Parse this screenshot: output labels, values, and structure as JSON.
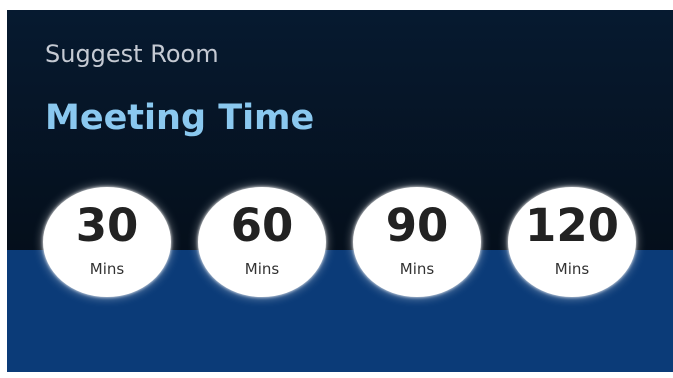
{
  "header": {
    "subtitle": "Suggest Room",
    "title": "Meeting Time"
  },
  "durations": [
    {
      "value": "30",
      "unit": "Mins"
    },
    {
      "value": "60",
      "unit": "Mins"
    },
    {
      "value": "90",
      "unit": "Mins"
    },
    {
      "value": "120",
      "unit": "Mins"
    }
  ],
  "colors": {
    "background_top": "#061a30",
    "band": "#0b3b78",
    "title": "#8ac8ef",
    "subtitle": "#c5cad3",
    "option_fill": "#ffffff"
  }
}
